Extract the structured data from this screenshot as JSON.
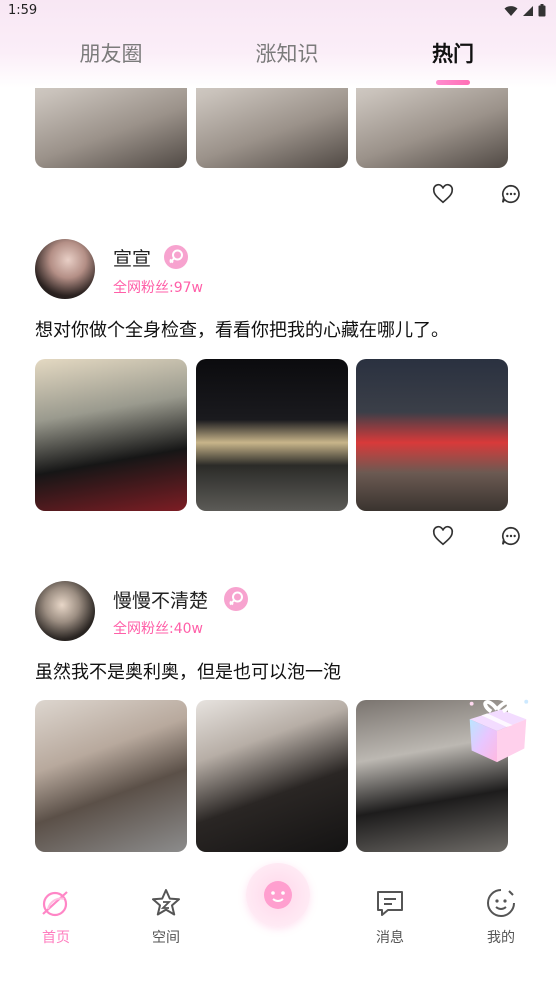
{
  "status": {
    "time": "1:59"
  },
  "tabs": [
    {
      "label": "朋友圈"
    },
    {
      "label": "涨知识"
    },
    {
      "label": "热门"
    }
  ],
  "posts": [
    {
      "username": "宣宣",
      "followers": "全网粉丝:97w",
      "text": "想对你做个全身检查，看看你把我的心藏在哪儿了。"
    },
    {
      "username": "慢慢不清楚",
      "followers": "全网粉丝:40w",
      "text": "虽然我不是奥利奥，但是也可以泡一泡"
    }
  ],
  "nav": [
    {
      "label": "首页",
      "icon": "home-icon",
      "active": true
    },
    {
      "label": "空间",
      "icon": "star-icon",
      "active": false
    },
    {
      "label": "消息",
      "icon": "message-icon",
      "active": false
    },
    {
      "label": "我的",
      "icon": "profile-icon",
      "active": false
    }
  ],
  "colors": {
    "accent": "#ff7dbf",
    "followers": "#ff5fa8",
    "badge": "#f7a3cf"
  }
}
